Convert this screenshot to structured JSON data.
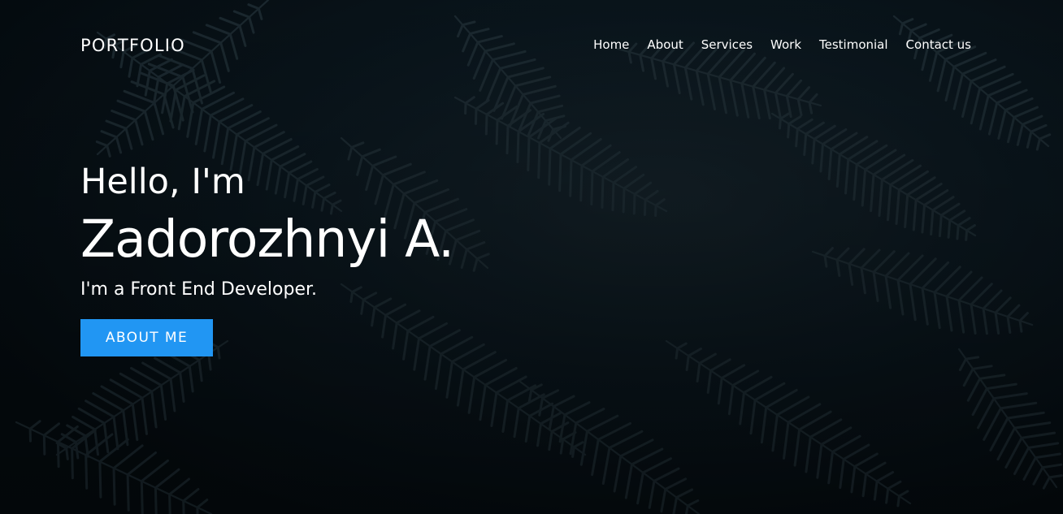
{
  "brand": {
    "label": "PORTFOLIO"
  },
  "nav": {
    "items": [
      {
        "label": "Home"
      },
      {
        "label": "About"
      },
      {
        "label": "Services"
      },
      {
        "label": "Work"
      },
      {
        "label": "Testimonial"
      },
      {
        "label": "Contact us"
      }
    ]
  },
  "hero": {
    "greeting": "Hello, I'm",
    "name": "Zadorozhnyi A.",
    "role": "I'm a Front End Developer.",
    "cta_label": "ABOUT ME",
    "background_image": "dark-fern-leaves"
  },
  "colors": {
    "background": "#071219",
    "text": "#ffffff",
    "accent": "#2196f3"
  }
}
